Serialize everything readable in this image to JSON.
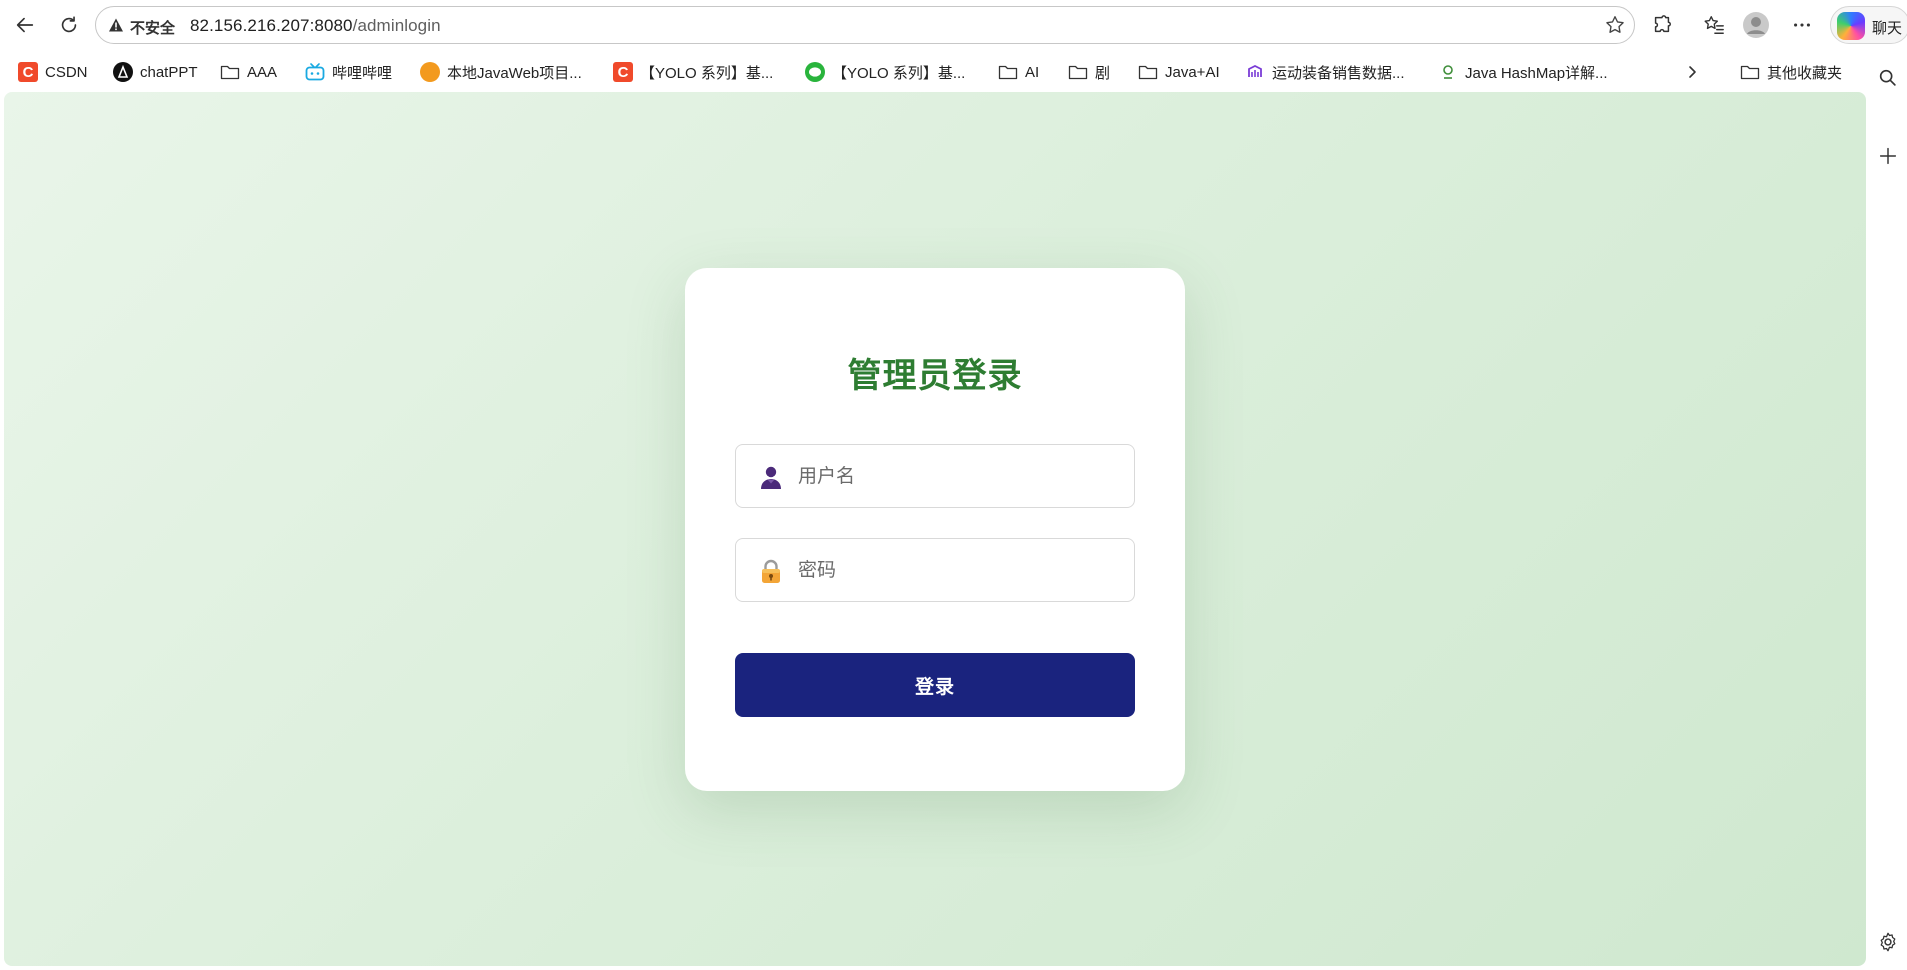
{
  "browser": {
    "security_label": "不安全",
    "url_host": "82.156.216.207:8080",
    "url_path": "/adminlogin",
    "copilot_label": "聊天"
  },
  "bookmarks": [
    {
      "label": "CSDN",
      "icon": "csdn-icon"
    },
    {
      "label": "chatPPT",
      "icon": "chatppt-icon"
    },
    {
      "label": "AAA",
      "icon": "folder-icon"
    },
    {
      "label": "哔哩哔哩",
      "icon": "bilibili-icon"
    },
    {
      "label": "本地JavaWeb项目...",
      "icon": "site-icon"
    },
    {
      "label": "【YOLO 系列】基...",
      "icon": "csdn-icon"
    },
    {
      "label": "【YOLO 系列】基...",
      "icon": "wechat-icon"
    },
    {
      "label": "AI",
      "icon": "folder-icon"
    },
    {
      "label": "剧",
      "icon": "folder-icon"
    },
    {
      "label": "Java+AI",
      "icon": "folder-icon"
    },
    {
      "label": "运动装备销售数据...",
      "icon": "site-icon"
    },
    {
      "label": "Java HashMap详解...",
      "icon": "site-icon"
    },
    {
      "label": "其他收藏夹",
      "icon": "folder-icon"
    }
  ],
  "login": {
    "title": "管理员登录",
    "username_placeholder": "用户名",
    "password_placeholder": "密码",
    "submit_label": "登录"
  },
  "colors": {
    "title": "#2e7d32",
    "button": "#1a237e",
    "background": "#dcefdc"
  }
}
